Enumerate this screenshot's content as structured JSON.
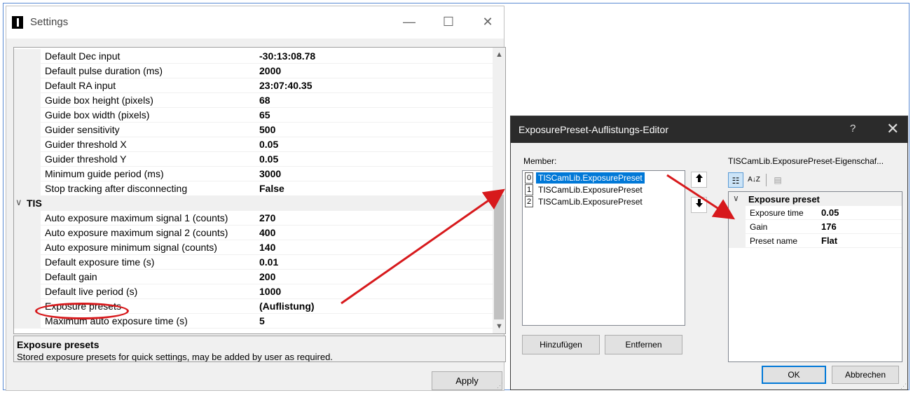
{
  "settings": {
    "title": "Settings",
    "controls": {
      "minimize": "—",
      "maximize": "☐",
      "close": "✕"
    },
    "rows": [
      {
        "name": "Default Dec input",
        "value": "-30:13:08.78"
      },
      {
        "name": "Default pulse duration (ms)",
        "value": "2000"
      },
      {
        "name": "Default RA input",
        "value": "23:07:40.35"
      },
      {
        "name": "Guide box height (pixels)",
        "value": "68"
      },
      {
        "name": "Guide box width (pixels)",
        "value": "65"
      },
      {
        "name": "Guider sensitivity",
        "value": "500"
      },
      {
        "name": "Guider threshold X",
        "value": "0.05"
      },
      {
        "name": "Guider threshold Y",
        "value": "0.05"
      },
      {
        "name": "Minimum guide period (ms)",
        "value": "3000"
      },
      {
        "name": "Stop tracking after disconnecting",
        "value": "False"
      },
      {
        "name": "Auto exposure maximum signal 1 (counts)",
        "value": "270"
      },
      {
        "name": "Auto exposure maximum signal 2 (counts)",
        "value": "400"
      },
      {
        "name": "Auto exposure minimum signal (counts)",
        "value": "140"
      },
      {
        "name": "Default exposure time (s)",
        "value": "0.01"
      },
      {
        "name": "Default gain",
        "value": "200"
      },
      {
        "name": "Default live period (s)",
        "value": "1000"
      },
      {
        "name": "Exposure presets",
        "value": "(Auflistung)"
      },
      {
        "name": "Maximum auto exposure time (s)",
        "value": "5"
      }
    ],
    "category": {
      "name": "TIS",
      "chevron": "∨"
    },
    "description": {
      "title": "Exposure presets",
      "text": "Stored exposure presets for quick settings, may be added by user as required."
    },
    "apply_label": "Apply"
  },
  "editor": {
    "title": "ExposurePreset-Auflistungs-Editor",
    "help": "?",
    "close": "✕",
    "member_label": "Member:",
    "props_label": "TISCamLib.ExposurePreset-Eigenschaf...",
    "members": [
      {
        "index": "0",
        "label": "TISCamLib.ExposurePreset"
      },
      {
        "index": "1",
        "label": "TISCamLib.ExposurePreset"
      },
      {
        "index": "2",
        "label": "TISCamLib.ExposurePreset"
      }
    ],
    "add_label": "Hinzufügen",
    "remove_label": "Entfernen",
    "ok_label": "OK",
    "cancel_label": "Abbrechen",
    "props": {
      "category": "Exposure preset",
      "items": [
        {
          "name": "Exposure time",
          "value": "0.05"
        },
        {
          "name": "Gain",
          "value": "176"
        },
        {
          "name": "Preset name",
          "value": "Flat"
        }
      ]
    }
  },
  "icons": {
    "up": "▲",
    "down": "▼",
    "move_up": "🡑",
    "move_down": "🡓",
    "sort_alpha": "A↓Z",
    "categorized": "☷",
    "prop_pages": "▤"
  },
  "colors": {
    "selection": "#0078d7",
    "annotation_red": "#d7191c",
    "editor_titlebar": "#2b2b2b"
  }
}
